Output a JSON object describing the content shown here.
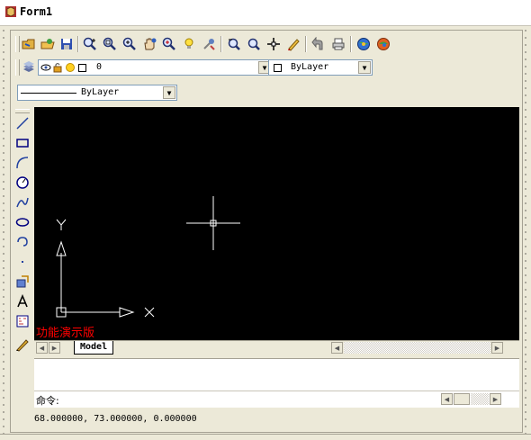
{
  "window": {
    "title": "Form1"
  },
  "toolbar": {
    "icons": [
      "open-icon",
      "open-folder-icon",
      "save-icon",
      "zoom-realtime-icon",
      "zoom-window-icon",
      "zoom-extents-icon",
      "pan-hand-icon",
      "zoom-in-icon",
      "light-bulb-icon",
      "layer-tool-icon",
      "zoom-previous-icon",
      "magnifier-icon",
      "move-cross-icon",
      "pencil-icon",
      "undo-arrow-icon",
      "print-icon",
      "color-globe-icon",
      "redraw-globe-icon"
    ]
  },
  "layer_bar": {
    "layer_value": "0",
    "color_value": "ByLayer",
    "linetype_value": "ByLayer"
  },
  "draw_tools": [
    "line-tool-icon",
    "rectangle-tool-icon",
    "arc-tool-icon",
    "circle-tool-icon",
    "spline-tool-icon",
    "ellipse-tool-icon",
    "curve-tool-icon",
    "point-tool-icon",
    "block-insert-icon",
    "text-tool-icon",
    "hatch-tool-icon",
    "edit-pencil-icon"
  ],
  "canvas": {
    "background": "#000000",
    "ucs_x_label": "X",
    "ucs_y_label": "Y",
    "watermark": "功能演示版"
  },
  "tabs": {
    "model": "Model"
  },
  "command": {
    "prompt": "命令:",
    "value": ""
  },
  "status": {
    "coords": "68.000000,   73.000000,   0.000000"
  }
}
